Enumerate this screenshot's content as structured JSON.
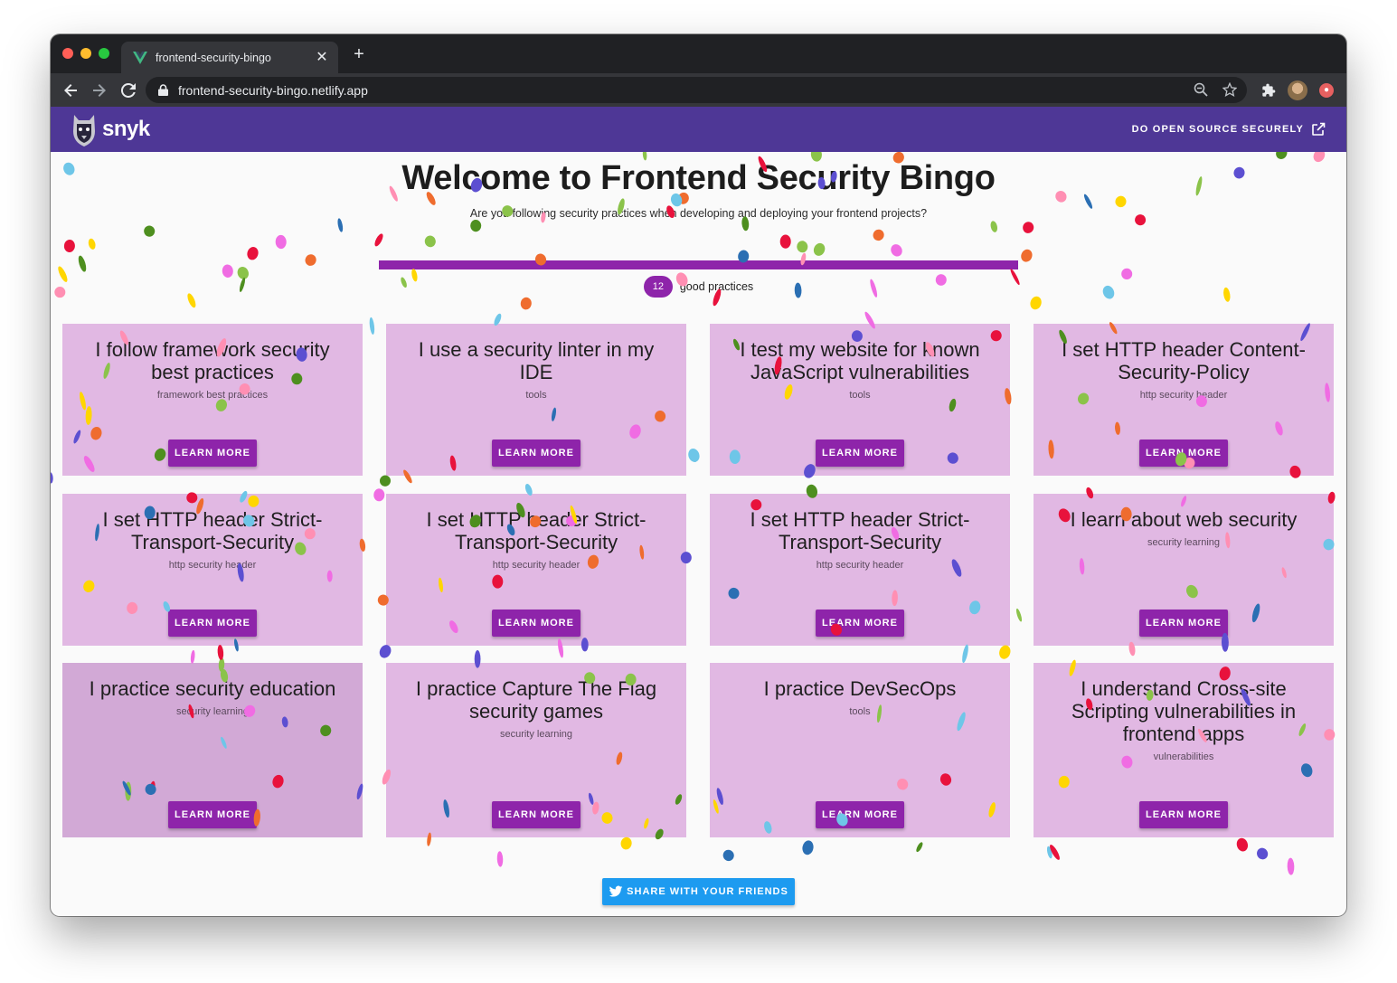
{
  "browser": {
    "tab_title": "frontend-security-bingo",
    "new_tab_symbol": "+",
    "close_symbol": "✕",
    "url": "frontend-security-bingo.netlify.app"
  },
  "header": {
    "brand": "snyk",
    "link_label": "DO OPEN SOURCE SECURELY"
  },
  "main": {
    "title": "Welcome to Frontend Security Bingo",
    "subtitle": "Are you following security practices when developing and deploying your frontend projects?",
    "progress": 1.0,
    "count": "12",
    "count_label": "good practices"
  },
  "cards": [
    {
      "title": "I follow framework security best practices",
      "tag": "framework best practices",
      "button": "LEARN MORE"
    },
    {
      "title": "I use a security linter in my IDE",
      "tag": "tools",
      "button": "LEARN MORE"
    },
    {
      "title": "I test my website for known JavaScript vulnerabilities",
      "tag": "tools",
      "button": "LEARN MORE"
    },
    {
      "title": "I set HTTP header Content-Security-Policy",
      "tag": "http security header",
      "button": "LEARN MORE"
    },
    {
      "title": "I set HTTP header Strict-Transport-Security",
      "tag": "http security header",
      "button": "LEARN MORE"
    },
    {
      "title": "I set HTTP header Strict-Transport-Security",
      "tag": "http security header",
      "button": "LEARN MORE"
    },
    {
      "title": "I set HTTP header Strict-Transport-Security",
      "tag": "http security header",
      "button": "LEARN MORE"
    },
    {
      "title": "I learn about web security",
      "tag": "security learning",
      "button": "LEARN MORE"
    },
    {
      "title": "I practice security education",
      "tag": "security learning",
      "button": "LEARN MORE"
    },
    {
      "title": "I practice Capture The Flag security games",
      "tag": "security learning",
      "button": "LEARN MORE"
    },
    {
      "title": "I practice DevSecOps",
      "tag": "tools",
      "button": "LEARN MORE"
    },
    {
      "title": "I understand Cross-site Scripting vulnerabilities in frontend apps",
      "tag": "vulnerabilities",
      "button": "LEARN MORE"
    }
  ],
  "share_label": "SHARE WITH YOUR FRIENDS",
  "colors": {
    "appbar": "#4e3796",
    "accent": "#8e24aa",
    "card": "#e1b8e3",
    "card_selected": "#d2a9d6",
    "twitter": "#1d9bf0"
  },
  "icons": [
    "vue-icon",
    "back-icon",
    "forward-icon",
    "reload-icon",
    "lock-icon",
    "zoom-icon",
    "star-icon",
    "extensions-icon",
    "avatar",
    "external-link-icon",
    "twitter-icon",
    "snyk-logo"
  ]
}
